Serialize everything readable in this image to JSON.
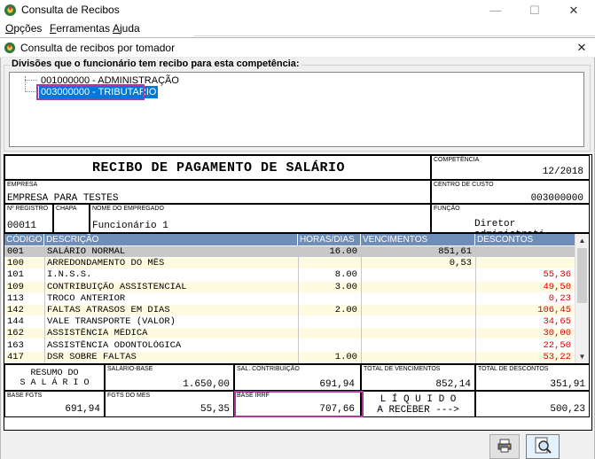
{
  "window": {
    "title": "Consulta de Recibos",
    "minimize": "—",
    "maximize": "☐",
    "close": "✕"
  },
  "menu": [
    {
      "label": "Opções",
      "accel": "O",
      "rest": "pções"
    },
    {
      "label": "Ferramentas",
      "accel": "F",
      "rest": "erramentas"
    },
    {
      "label": "Ajuda",
      "accel": "A",
      "rest": "juda"
    }
  ],
  "child": {
    "title": "Consulta de recibos por tomador",
    "close": "✕"
  },
  "divisions": {
    "label": "Divisões que o funcionário tem recibo para esta competência:",
    "items": [
      "001000000 - ADMINISTRAÇÃO",
      "003000000 - TRIBUTARIO"
    ],
    "selected_index": 1
  },
  "receipt": {
    "title": "RECIBO DE PAGAMENTO DE SALÁRIO",
    "competencia_label": "COMPETÊNCIA",
    "competencia": "12/2018",
    "empresa_label": "EMPRESA",
    "empresa": "EMPRESA PARA TESTES",
    "centro_label": "CENTRO DE CUSTO",
    "centro": "003000000",
    "registro_label": "Nº REGISTRO",
    "registro": "00011",
    "chapa_label": "CHAPA",
    "chapa": "",
    "nome_label": "NOME DO EMPREGADO",
    "nome": "Funcionário 1",
    "funcao_label": "FUNÇÃO",
    "funcao": "Diretor administrati"
  },
  "table": {
    "headers": [
      "CÓDIGO",
      "DESCRIÇÃO",
      "HORAS/DIAS",
      "VENCIMENTOS",
      "DESCONTOS"
    ],
    "rows": [
      {
        "codigo": "001",
        "descricao": "SALÁRIO NORMAL",
        "horas": "16.00",
        "venc": "851,61",
        "desc": ""
      },
      {
        "codigo": "100",
        "descricao": "ARREDONDAMENTO DO MÊS",
        "horas": "",
        "venc": "0,53",
        "desc": ""
      },
      {
        "codigo": "101",
        "descricao": "I.N.S.S.",
        "horas": "8.00",
        "venc": "",
        "desc": "55,36"
      },
      {
        "codigo": "109",
        "descricao": "CONTRIBUIÇÃO ASSISTENCIAL",
        "horas": "3.00",
        "venc": "",
        "desc": "49,50"
      },
      {
        "codigo": "113",
        "descricao": "TROCO ANTERIOR",
        "horas": "",
        "venc": "",
        "desc": "0,23"
      },
      {
        "codigo": "142",
        "descricao": "FALTAS ATRASOS EM DIAS",
        "horas": "2.00",
        "venc": "",
        "desc": "106,45"
      },
      {
        "codigo": "144",
        "descricao": "VALE TRANSPORTE (VALOR)",
        "horas": "",
        "venc": "",
        "desc": "34,65"
      },
      {
        "codigo": "162",
        "descricao": "ASSISTÊNCIA MÉDICA",
        "horas": "",
        "venc": "",
        "desc": "30,00"
      },
      {
        "codigo": "163",
        "descricao": "ASSISTÊNCIA ODONTOLÓGICA",
        "horas": "",
        "venc": "",
        "desc": "22,50"
      },
      {
        "codigo": "417",
        "descricao": "DSR SOBRE FALTAS",
        "horas": "1.00",
        "venc": "",
        "desc": "53,22"
      }
    ],
    "selected_row": 0
  },
  "summary": {
    "resumo_line1": "RESUMO DO",
    "resumo_line2": "S A L Á R I O",
    "salario_base_label": "SALÁRIO-BASE",
    "salario_base": "1.650,00",
    "sal_contrib_label": "SAL. CONTRIBUIÇÃO",
    "sal_contrib": "691,94",
    "total_venc_label": "TOTAL DE VENCIMENTOS",
    "total_venc": "852,14",
    "total_desc_label": "TOTAL DE DESCONTOS",
    "total_desc": "351,91",
    "base_fgts_label": "BASE FGTS",
    "base_fgts": "691,94",
    "fgts_mes_label": "FGTS DO MES",
    "fgts_mes": "55,35",
    "base_irrf_label": "BASE IRRF",
    "base_irrf": "707,66",
    "liquido_line1": "L Í Q U I D O",
    "liquido_line2": "A RECEBER --->",
    "liquido": "500,23"
  },
  "colors": {
    "header_bg": "#6e8db8",
    "row_alt": "#fffbe0",
    "selected_row": "#c8c8c8",
    "discount": "#e20000",
    "highlight": "#a93aa0"
  },
  "icons": [
    "app-icon",
    "child-icon",
    "printer-icon",
    "magnifier-icon",
    "scroll-up-icon",
    "scroll-down-icon"
  ]
}
